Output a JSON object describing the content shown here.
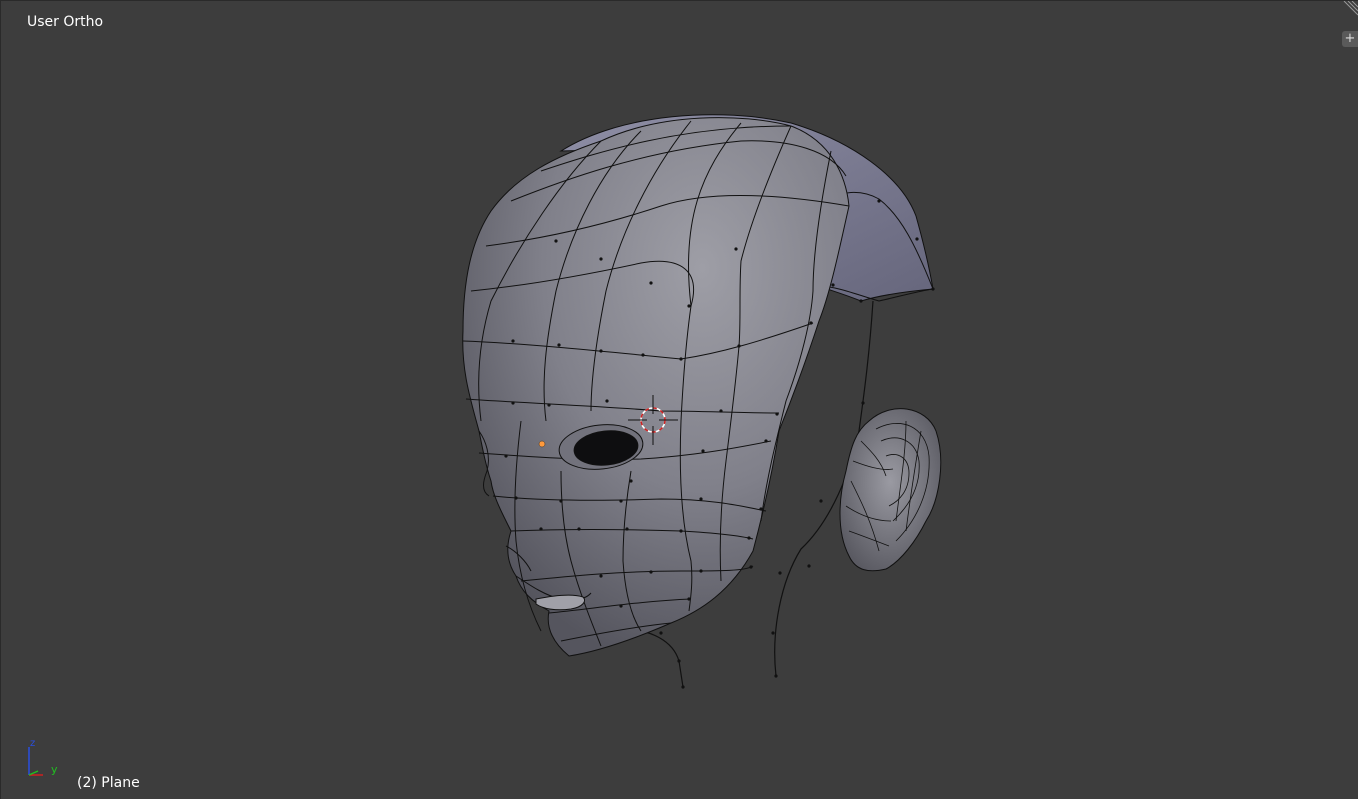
{
  "viewport": {
    "view_name": "User Ortho",
    "object_info": "(2) Plane",
    "properties_toggle_icon": "+"
  },
  "axis": {
    "z": "z",
    "y": "y"
  },
  "colors": {
    "background": "#3d3d3d",
    "mesh_fill": "#8a8a93",
    "wire": "#0a0a0a",
    "vertex_selected": "#ff9a3c",
    "cursor_red": "#cc2222",
    "axis_x": "#d02020",
    "axis_y": "#20c020",
    "axis_z": "#2a4fe0"
  },
  "icons": {
    "corner": "area-split-corner-icon",
    "cursor": "3d-cursor-icon"
  }
}
